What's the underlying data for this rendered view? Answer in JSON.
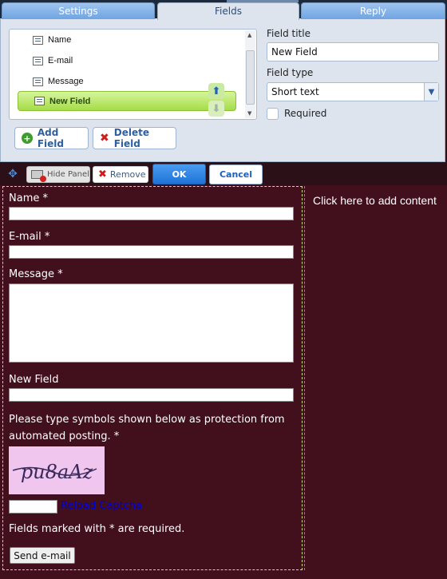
{
  "tabs": [
    {
      "label": "Settings"
    },
    {
      "label": "Fields"
    },
    {
      "label": "Reply"
    }
  ],
  "field_list": {
    "items": [
      "Name",
      "E-mail",
      "Message",
      "New Field"
    ],
    "selected": "New Field"
  },
  "field_props": {
    "title_label": "Field title",
    "title_value": "New Field",
    "type_label": "Field type",
    "type_value": "Short text",
    "required_label": "Required",
    "required_checked": false
  },
  "actions": {
    "add_field": "Add Field",
    "delete_field": "Delete Field"
  },
  "toolbar": {
    "hide_panel": "Hide Panel",
    "remove": "Remove",
    "ok": "OK",
    "cancel": "Cancel"
  },
  "form": {
    "name_label": "Name *",
    "email_label": "E-mail *",
    "message_label": "Message *",
    "new_field_label": "New Field",
    "captcha_prompt": "Please type symbols shown below as protection from automated posting. *",
    "captcha_text": "pu8aAz",
    "reload_captcha": "Reload Captcha",
    "required_note": "Fields marked with * are required.",
    "send_button": "Send e-mail"
  },
  "right_panel": {
    "placeholder": "Click here to add content"
  },
  "colors": {
    "page_bg": "#42101c",
    "selection_green": "#a6dc47",
    "ok_blue": "#1e73d8",
    "captcha_bg": "#f1c6ee"
  }
}
